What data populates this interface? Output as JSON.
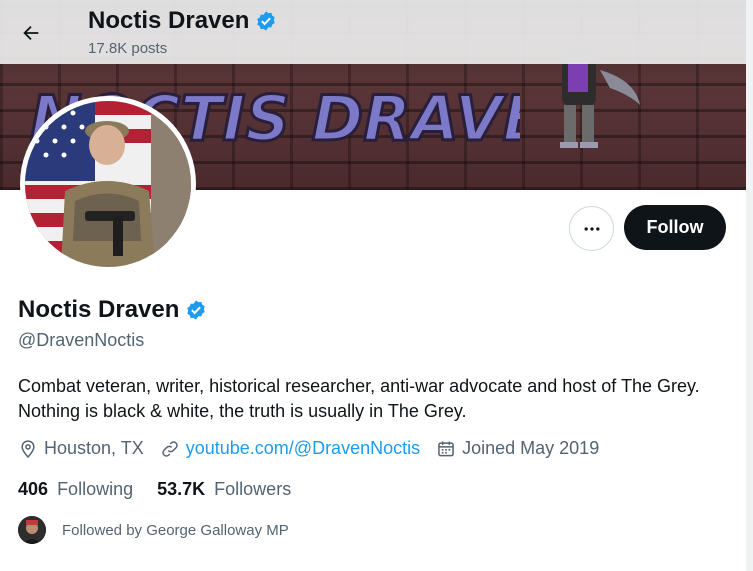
{
  "header": {
    "name": "Noctis Draven",
    "posts_count": "17.8K posts"
  },
  "banner": {
    "graffiti_text": "NOCTIS DRAVEN"
  },
  "actions": {
    "follow_label": "Follow",
    "more_icon": "ellipsis-icon"
  },
  "profile": {
    "display_name": "Noctis Draven",
    "handle": "@DravenNoctis",
    "bio": "Combat veteran, writer, historical researcher, anti-war advocate and host of The Grey. Nothing is black & white, the truth is usually in The Grey.",
    "location": "Houston, TX",
    "website": "youtube.com/@DravenNoctis",
    "joined": "Joined May 2019"
  },
  "stats": {
    "following_count": "406",
    "following_label": "Following",
    "followers_count": "53.7K",
    "followers_label": "Followers"
  },
  "followed_by": {
    "text": "Followed by George Galloway MP"
  },
  "colors": {
    "verified": "#1d9bf0",
    "link": "#1d9bf0",
    "primary_text": "#0f1419",
    "secondary_text": "#536471",
    "follow_bg": "#0f1419"
  }
}
